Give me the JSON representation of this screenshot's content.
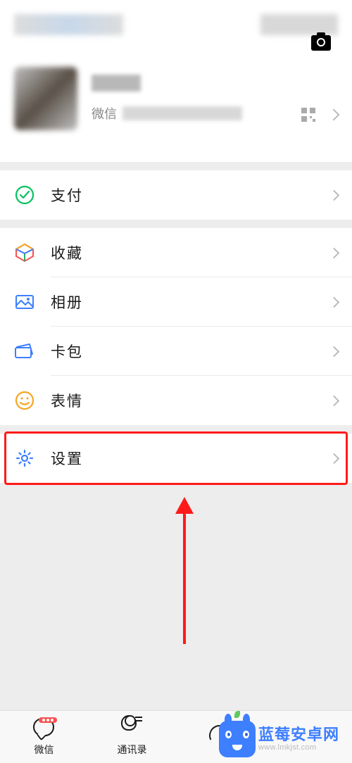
{
  "profile": {
    "id_prefix": "微信"
  },
  "menu": {
    "pay": "支付",
    "favorites": "收藏",
    "album": "相册",
    "cards": "卡包",
    "stickers": "表情",
    "settings": "设置"
  },
  "tabs": {
    "chats": "微信",
    "contacts": "通讯录"
  },
  "watermark": {
    "brand_cn": "蓝莓安卓网",
    "brand_en": "www.lmkjst.com"
  },
  "colors": {
    "pay": "#07c160",
    "favorites_a": "#fa5151",
    "favorites_b": "#2aae67",
    "favorites_c": "#3d7fff",
    "album": "#3d7fff",
    "cards": "#3d7fff",
    "stickers": "#f5a623",
    "settings": "#3d7fff"
  }
}
